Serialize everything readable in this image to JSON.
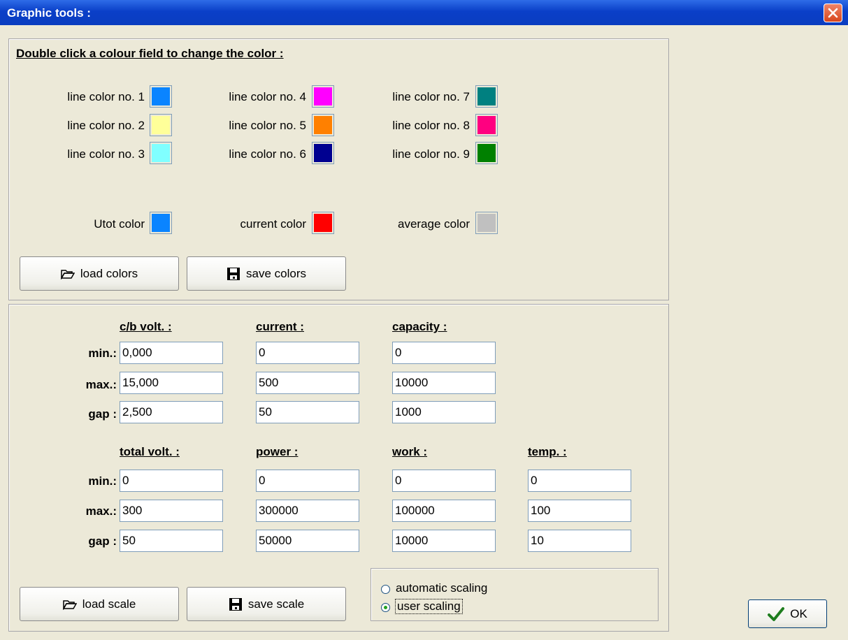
{
  "window": {
    "title": "Graphic tools :"
  },
  "colors_section": {
    "heading": "Double click a colour field to change the color :",
    "line_colors": [
      {
        "label": "line color no. 1",
        "color": "#0A84FF"
      },
      {
        "label": "line color no. 2",
        "color": "#FFFF99"
      },
      {
        "label": "line color no. 3",
        "color": "#80FFFF"
      },
      {
        "label": "line color no. 4",
        "color": "#FF00FF"
      },
      {
        "label": "line color no. 5",
        "color": "#FF8000"
      },
      {
        "label": "line color no. 6",
        "color": "#000090"
      },
      {
        "label": "line color no. 7",
        "color": "#008080"
      },
      {
        "label": "line color no. 8",
        "color": "#FF0080"
      },
      {
        "label": "line color no. 9",
        "color": "#008000"
      }
    ],
    "special_colors": [
      {
        "label": "Utot color",
        "color": "#0A84FF"
      },
      {
        "label": "current color",
        "color": "#FF0000"
      },
      {
        "label": "average color",
        "color": "#C0C0C0"
      }
    ],
    "load_colors_label": "load colors",
    "save_colors_label": "save colors"
  },
  "scale_section": {
    "row_labels": {
      "min": "min.:",
      "max": "max.:",
      "gap": "gap :"
    },
    "group1": [
      {
        "header": "c/b volt. :",
        "min": "0,000",
        "max": "15,000",
        "gap": "2,500"
      },
      {
        "header": "current :",
        "min": "0",
        "max": "500",
        "gap": "50"
      },
      {
        "header": "capacity :",
        "min": "0",
        "max": "10000",
        "gap": "1000"
      }
    ],
    "group2": [
      {
        "header": "total volt. :",
        "min": "0",
        "max": "300",
        "gap": "50"
      },
      {
        "header": "power :",
        "min": "0",
        "max": "300000",
        "gap": "50000"
      },
      {
        "header": "work :",
        "min": "0",
        "max": "100000",
        "gap": "10000"
      },
      {
        "header": "temp. :",
        "min": "0",
        "max": "100",
        "gap": "10"
      }
    ],
    "load_scale_label": "load scale",
    "save_scale_label": "save scale",
    "scaling_options": [
      {
        "label": "automatic scaling",
        "selected": false
      },
      {
        "label": "user scaling",
        "selected": true
      }
    ]
  },
  "ok_label": "OK",
  "icons": {
    "folder": "folder-open-icon",
    "save": "floppy-disk-icon",
    "ok": "checkmark-icon",
    "close": "close-icon"
  }
}
